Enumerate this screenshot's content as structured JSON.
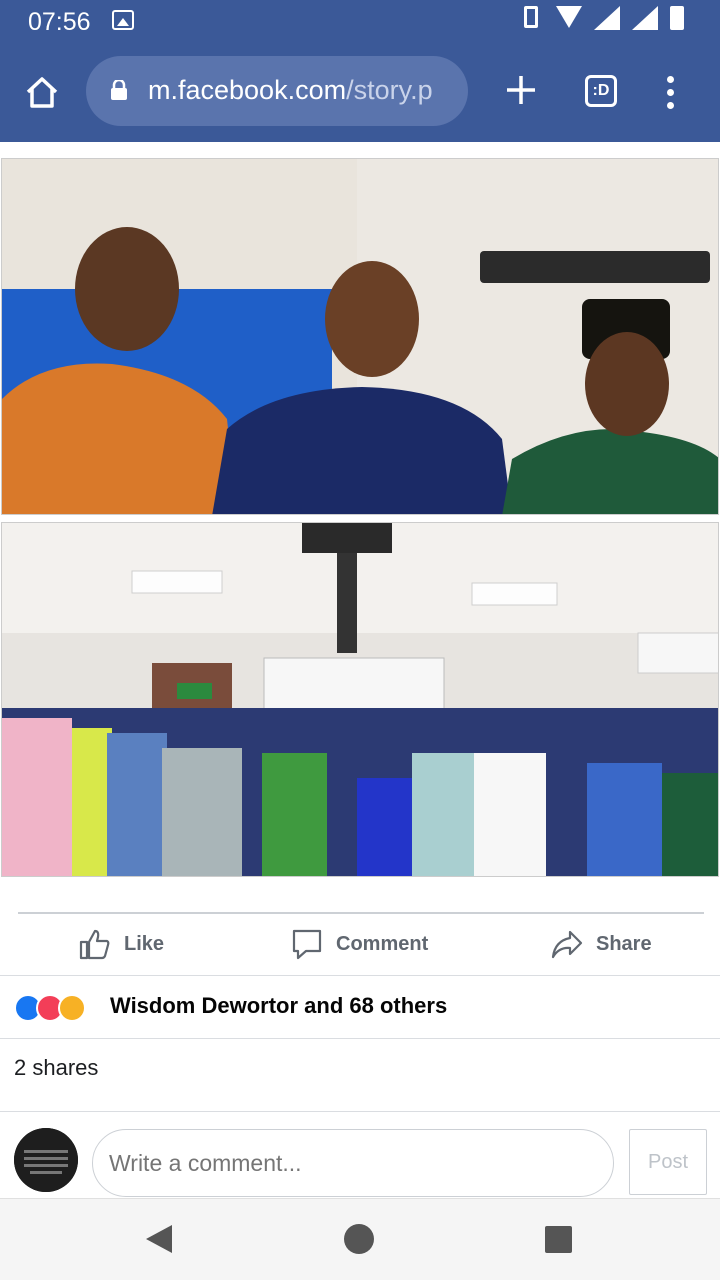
{
  "status_bar": {
    "time": "07:56",
    "icons": [
      "image-icon",
      "vibrate-icon",
      "wifi-icon",
      "signal-icon",
      "signal-x-icon",
      "battery-icon"
    ]
  },
  "browser": {
    "url_domain": "m.facebook.com",
    "url_path": "/story.p",
    "tabs_label": ":D",
    "icons": [
      "home-icon",
      "lock-icon",
      "plus-icon",
      "tabs-icon",
      "more-vert-icon"
    ]
  },
  "post": {
    "photos": [
      "photo-group-three-men",
      "photo-group-team"
    ],
    "actions": {
      "like": "Like",
      "comment": "Comment",
      "share": "Share"
    },
    "reactions": {
      "types": [
        "like",
        "love",
        "care"
      ],
      "summary": "Wisdom Dewortor and 68 others"
    },
    "shares": "2 shares"
  },
  "comment_box": {
    "avatar_text": "If someone comes across your mind, check on them. God did that for a reason",
    "placeholder": "Write a comment...",
    "post_label": "Post"
  },
  "colors": {
    "facebook_blue": "#3b5998",
    "url_box": "#5a74ad",
    "action_gray": "#606770",
    "like_blue": "#1877f2",
    "love_red": "#f33e58",
    "care_yellow": "#f7b125"
  }
}
